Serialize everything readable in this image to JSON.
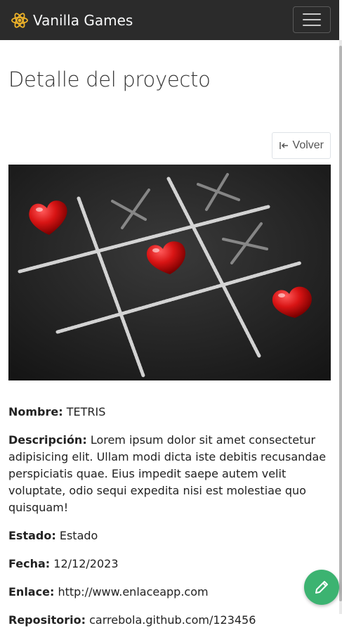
{
  "navbar": {
    "brand": "Vanilla Games",
    "brand_icon": "atom-icon",
    "menu_icon": "hamburger-menu-icon"
  },
  "page": {
    "title": "Detalle del proyecto",
    "back_label": "Volver",
    "back_icon": "arrow-left-to-bar-icon"
  },
  "project": {
    "image_alt": "tic-tac-toe chalk board with red hearts",
    "fields": [
      {
        "label": "Nombre:",
        "value": "TETRIS"
      },
      {
        "label": "Descripción:",
        "value": "Lorem ipsum dolor sit amet consectetur adipisicing elit. Ullam modi dicta iste debitis recusandae perspiciatis quae. Eius impedit saepe autem velit voluptate, odio sequi expedita nisi est molestiae quo quisquam!"
      },
      {
        "label": "Estado:",
        "value": "Estado"
      },
      {
        "label": "Fecha:",
        "value": "12/12/2023"
      },
      {
        "label": "Enlace:",
        "value": "http://www.enlaceapp.com"
      },
      {
        "label": "Repositorio:",
        "value": "carrebola.github.com/123456"
      }
    ]
  },
  "fab": {
    "icon": "pencil-icon"
  },
  "colors": {
    "navbar_bg": "#2b2b2b",
    "brand_icon": "#f0b429",
    "fab_bg": "#3cb371",
    "heart_red": "#d81414"
  }
}
